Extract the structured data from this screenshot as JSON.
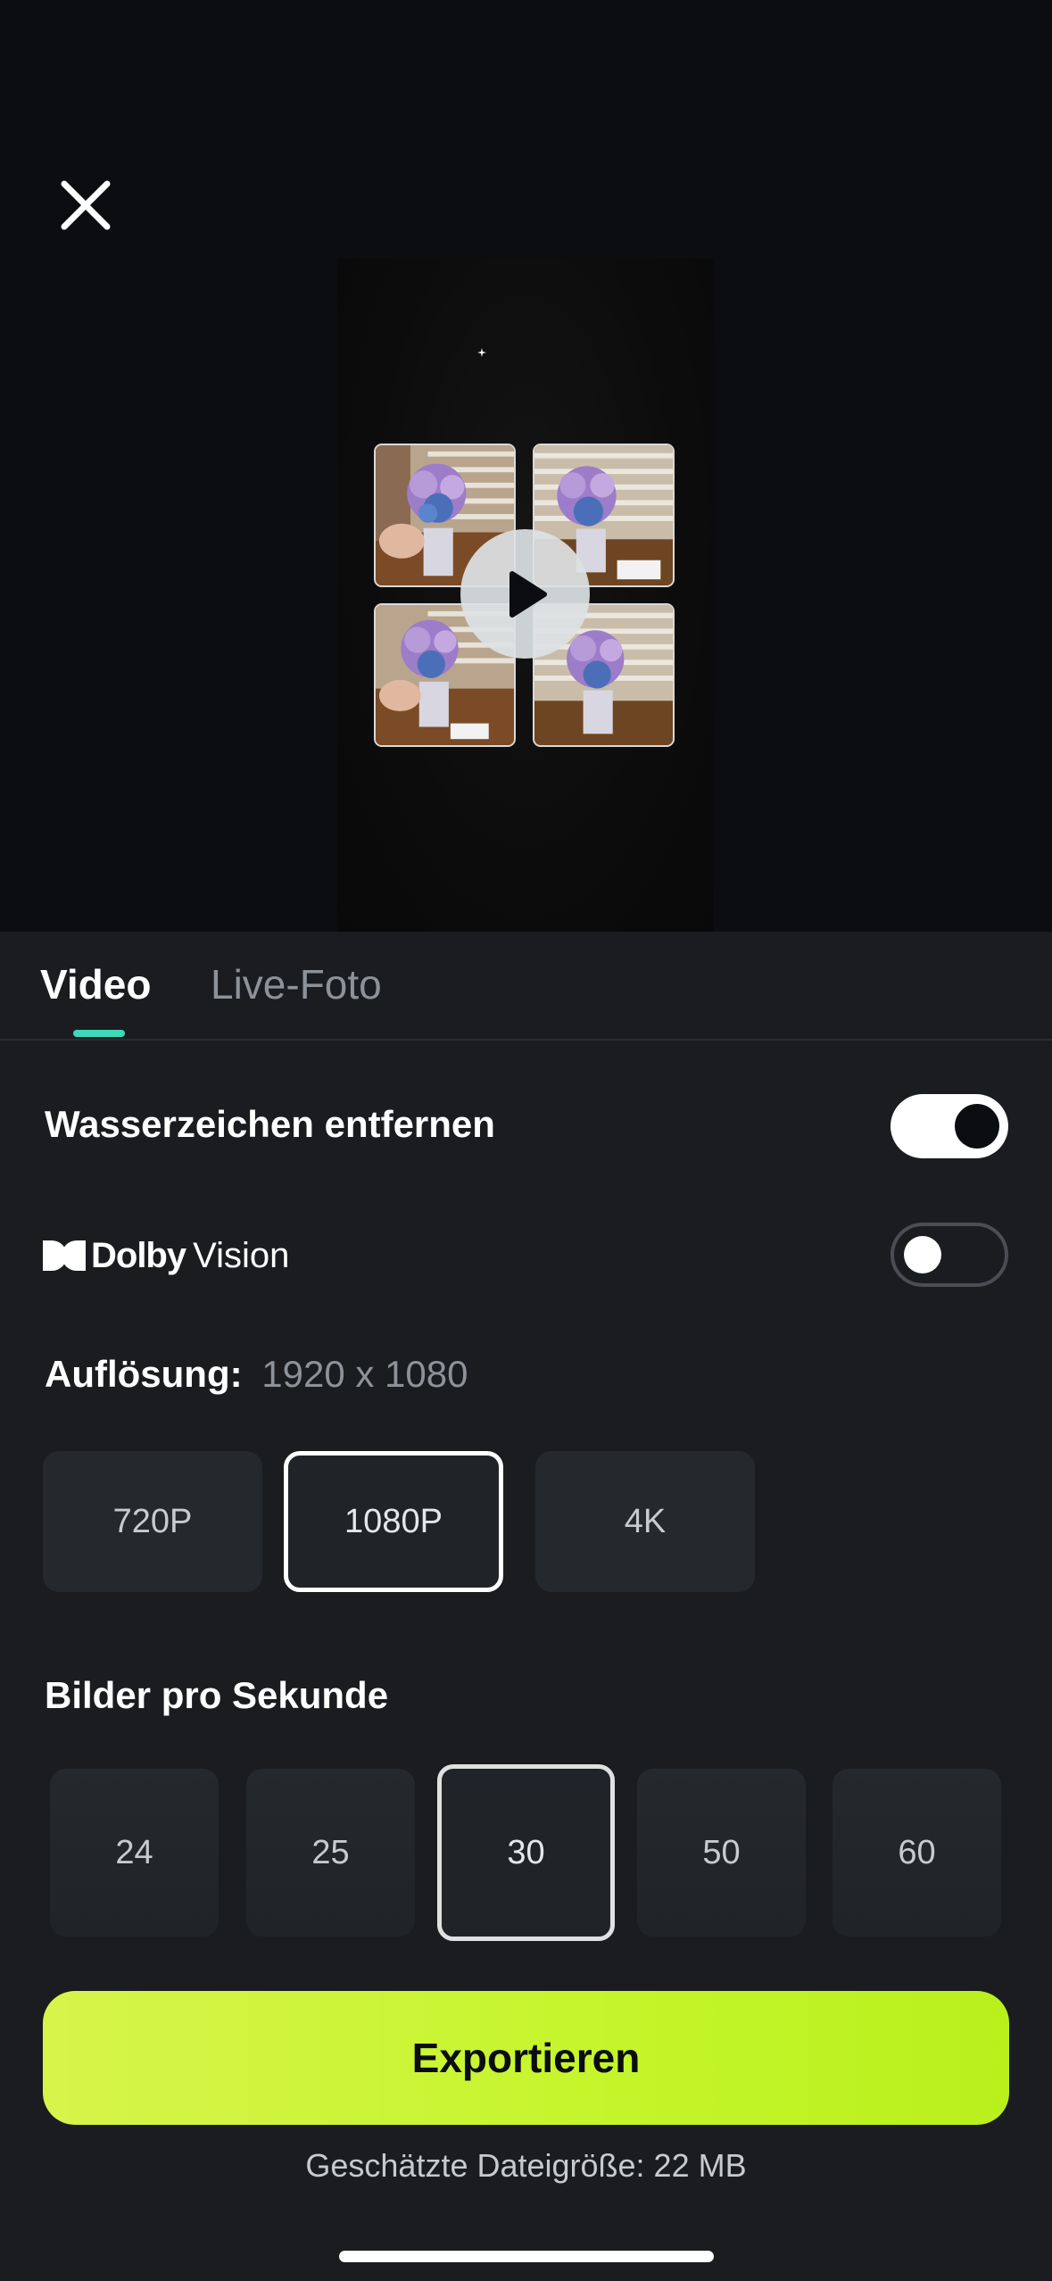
{
  "header": {
    "close_icon": "close-icon"
  },
  "preview": {
    "play_icon": "play-icon"
  },
  "tabs": [
    {
      "label": "Video",
      "active": true
    },
    {
      "label": "Live-Foto",
      "active": false
    }
  ],
  "colors": {
    "accent": "#3fd9b8",
    "export_start": "#d7f44a",
    "export_end": "#b9f01c",
    "panel_bg": "#1a1c20"
  },
  "settings": {
    "watermark": {
      "label": "Wasserzeichen entfernen",
      "enabled": true
    },
    "dolby": {
      "brand": "Dolby",
      "product": "Vision",
      "enabled": false
    }
  },
  "resolution": {
    "label": "Auflösung:",
    "value": "1920 x 1080",
    "options": [
      "720P",
      "1080P",
      "4K"
    ],
    "selected": "1080P"
  },
  "fps": {
    "label": "Bilder pro Sekunde",
    "options": [
      "24",
      "25",
      "30",
      "50",
      "60"
    ],
    "selected": "30"
  },
  "export": {
    "button_label": "Exportieren",
    "filesize": "Geschätzte Dateigröße: 22 MB"
  }
}
